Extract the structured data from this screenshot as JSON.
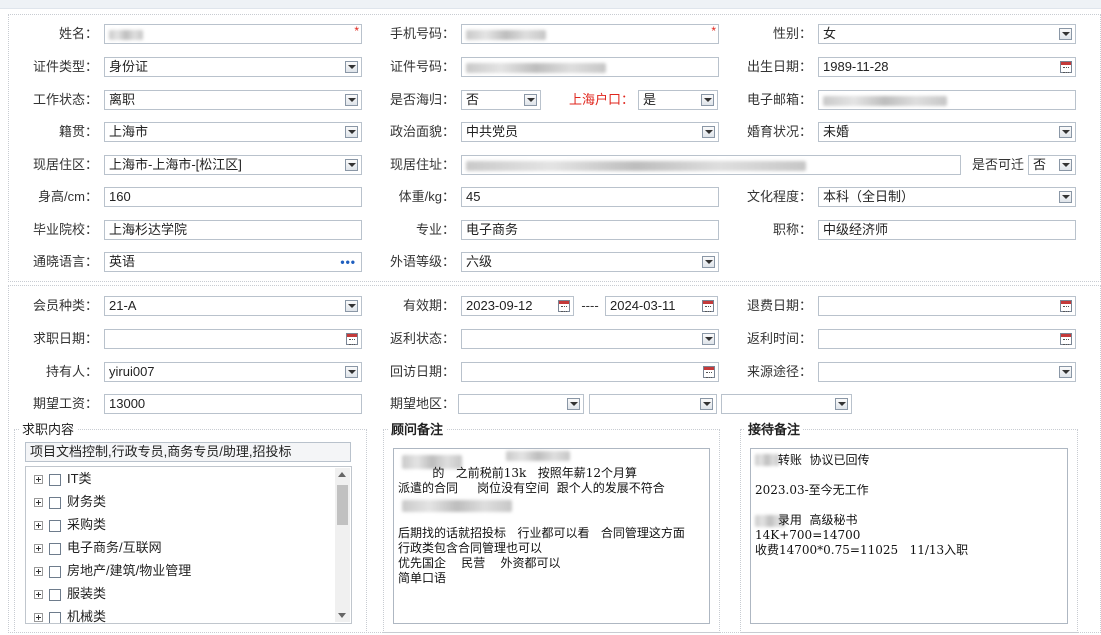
{
  "basic": {
    "name_label": "姓名：",
    "phone_label": "手机号码：",
    "gender_label": "性别：",
    "gender_value": "女",
    "id_type_label": "证件类型：",
    "id_type_value": "身份证",
    "id_no_label": "证件号码：",
    "birth_label": "出生日期：",
    "birth_value": "1989-11-28",
    "work_status_label": "工作状态：",
    "work_status_value": "离职",
    "returnee_label": "是否海归：",
    "returnee_value": "否",
    "shanghai_hukou_label": "上海户口：",
    "shanghai_hukou_value": "是",
    "email_label": "电子邮箱：",
    "native_label": "籍贯：",
    "native_value": "上海市",
    "political_label": "政治面貌：",
    "political_value": "中共党员",
    "marital_label": "婚育状况：",
    "marital_value": "未婚",
    "residence_area_label": "现居住区：",
    "residence_area_value": "上海市-上海市-[松江区]",
    "address_label": "现居住址：",
    "relocate_label": "是否可迁",
    "relocate_value": "否",
    "height_label": "身高/cm：",
    "height_value": "160",
    "weight_label": "体重/kg：",
    "weight_value": "45",
    "education_label": "文化程度：",
    "education_value": "本科（全日制）",
    "school_label": "毕业院校：",
    "school_value": "上海杉达学院",
    "major_label": "专业：",
    "major_value": "电子商务",
    "title_label": "职称：",
    "title_value": "中级经济师",
    "language_label": "通晓语言：",
    "language_value": "英语",
    "foreign_level_label": "外语等级：",
    "foreign_level_value": "六级",
    "required_mark": "*",
    "more_icon_text": "•••"
  },
  "member": {
    "type_label": "会员种类：",
    "type_value": "21-A",
    "valid_label": "有效期：",
    "valid_from": "2023-09-12",
    "valid_sep": "----",
    "valid_to": "2024-03-11",
    "refund_date_label": "退费日期：",
    "job_date_label": "求职日期：",
    "rebate_status_label": "返利状态：",
    "rebate_time_label": "返利时间：",
    "holder_label": "持有人：",
    "holder_value": "yirui007",
    "revisit_label": "回访日期：",
    "source_label": "来源途径：",
    "salary_label": "期望工资：",
    "salary_value": "13000",
    "region_label": "期望地区："
  },
  "job_content": {
    "title": "求职内容",
    "summary": "项目文档控制,行政专员,商务专员/助理,招投标",
    "categories": [
      "IT类",
      "财务类",
      "采购类",
      "电子商务/互联网",
      "房地产/建筑/物业管理",
      "服装类",
      "机械类"
    ]
  },
  "consultant_notes": {
    "title": "顾问备注",
    "lines": [
      "         的   之前税前13k   按照年薪12个月算",
      "派遣的合同     岗位没有空间  跟个人的发展不符合",
      "",
      "",
      "后期找的话就招投标   行业都可以看   合同管理这方面",
      "行政类包含合同管理也可以",
      "优先国企    民营    外资都可以",
      "简单口语"
    ]
  },
  "reception_notes": {
    "title": "接待备注",
    "lines": [
      "      转账  协议已回传",
      "",
      "2023.03-至今无工作",
      "",
      "      录用  高级秘书",
      "14K+700=14700",
      "收费14700*0.75=11025   11/13入职"
    ]
  }
}
